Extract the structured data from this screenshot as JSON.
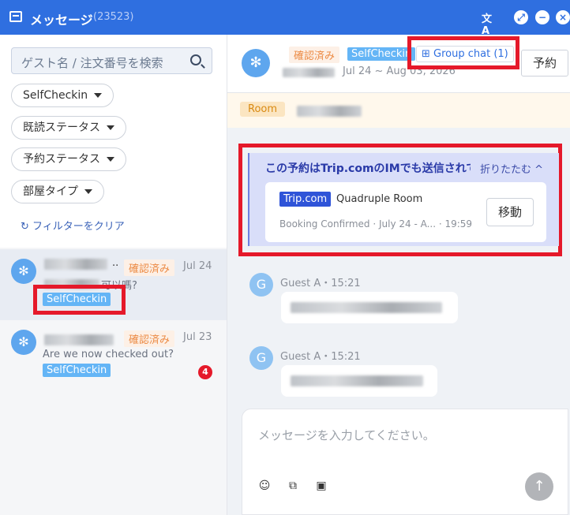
{
  "window": {
    "title": "メッセージ",
    "count": "(23523)",
    "translate_icon": "translate-icon",
    "expand_icon": "expand-icon",
    "minimize_icon": "minimize-icon",
    "close_icon": "close-icon"
  },
  "sidebar": {
    "search_placeholder": "ゲスト名 / 注文番号を検索",
    "filters": [
      {
        "label": "SelfCheckin"
      },
      {
        "label": "既読ステータス"
      },
      {
        "label": "予約ステータス"
      },
      {
        "label": "部屋タイプ"
      }
    ],
    "clear_filters": "フィルターをクリア",
    "conversations": [
      {
        "status": "確認済み",
        "date": "Jul 24",
        "name_suffix": "..",
        "preview": "可以嗎?",
        "tag": "SelfCheckin",
        "unread": ""
      },
      {
        "status": "確認済み",
        "date": "Jul 23",
        "name_suffix": "",
        "preview": "Are we now checked out?",
        "tag": "SelfCheckin",
        "unread": "4"
      }
    ]
  },
  "chat": {
    "status_tag": "確認済み",
    "selfcheckin_tag": "SelfCheckin",
    "group_chat": "Group chat (1)",
    "dates": "Jul 24 ~ Aug 03, 2026",
    "reserve_button": "予約",
    "room_label": "Room",
    "notice": {
      "text": "この予約はTrip.comのIMでも送信されています",
      "fold": "折りたたむ ^",
      "brand": "Trip.com",
      "room_type": "Quadruple Room",
      "meta": "Booking Confirmed · July 24 - A...  · 19:59",
      "move_button": "移動"
    },
    "messages": [
      {
        "avatar": "G",
        "sender": "Guest A・15:21"
      },
      {
        "avatar": "G",
        "sender": "Guest A・15:21"
      }
    ],
    "input_placeholder": "メッセージを入力してください。"
  },
  "colors": {
    "titlebar": "#2f6fe0",
    "highlight_box": "#e5192a",
    "confirmed_tag": "#ec8b45",
    "selfcheckin_tag": "#64b5f6"
  }
}
